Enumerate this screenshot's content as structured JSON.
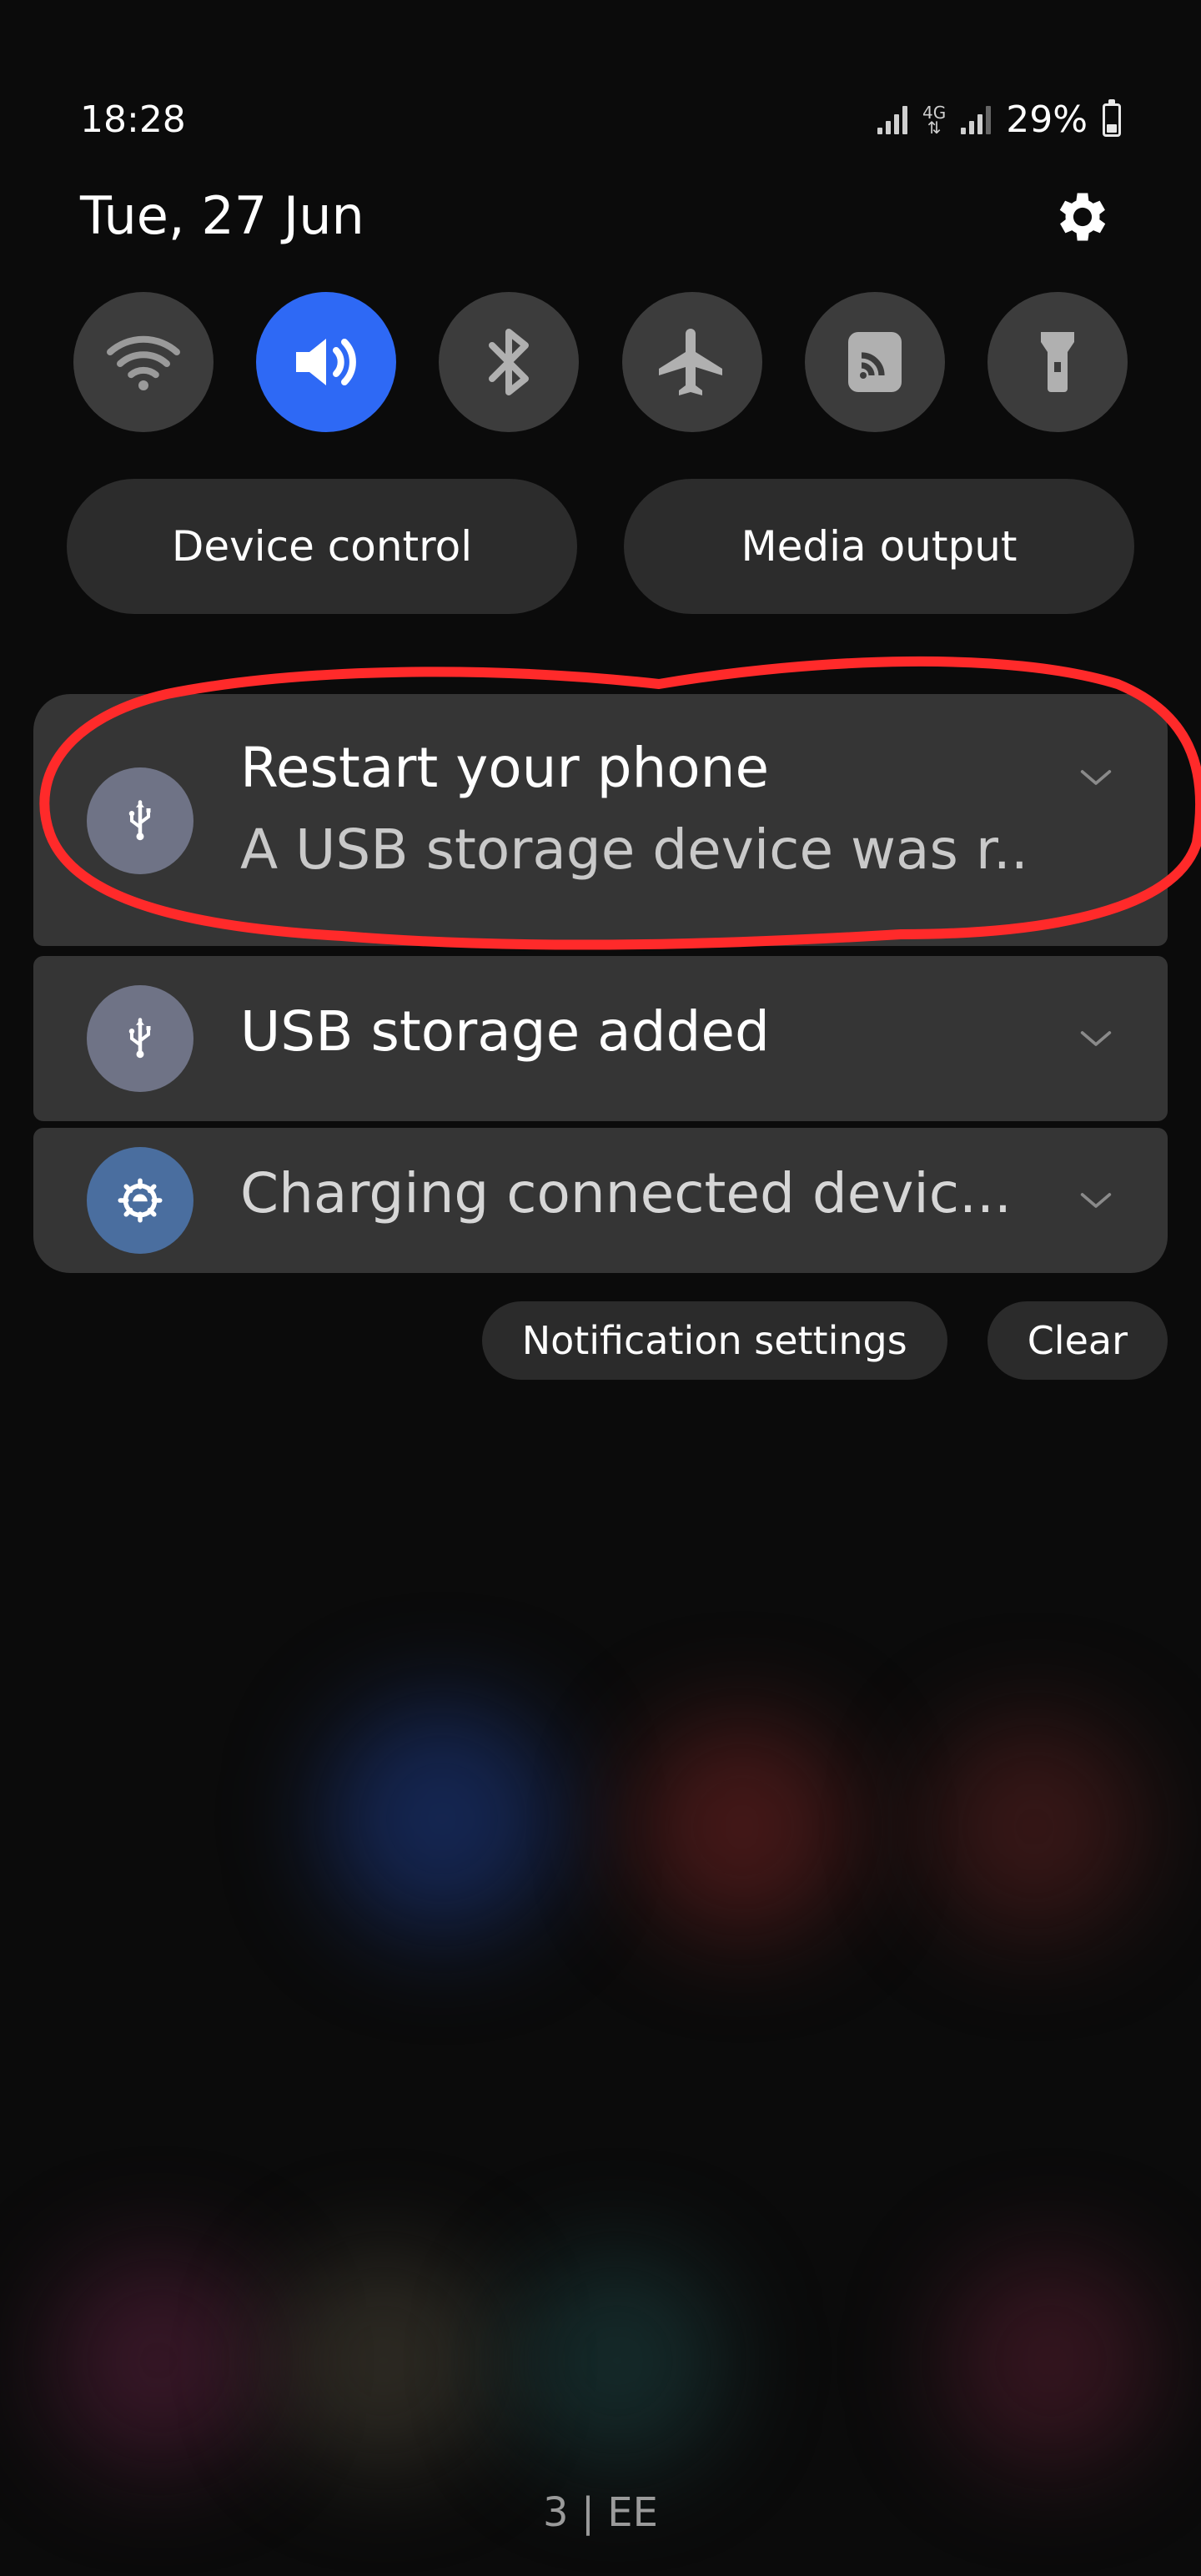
{
  "status": {
    "time": "18:28",
    "network_type": "4G",
    "battery_percent": "29%",
    "battery_level": 0.29
  },
  "header": {
    "date": "Tue, 27 Jun"
  },
  "quick_settings": [
    {
      "icon": "wifi-icon",
      "active": false
    },
    {
      "icon": "sound-icon",
      "active": true
    },
    {
      "icon": "bluetooth-icon",
      "active": false
    },
    {
      "icon": "airplane-mode-icon",
      "active": false
    },
    {
      "icon": "nfc-icon",
      "active": false
    },
    {
      "icon": "flashlight-icon",
      "active": false
    }
  ],
  "pills": {
    "device_control": "Device control",
    "media_output": "Media output"
  },
  "notifications": [
    {
      "icon": "usb-icon",
      "title": "Restart your phone",
      "body": "A USB storage device was r.."
    },
    {
      "icon": "usb-icon",
      "title": "USB storage added"
    },
    {
      "icon": "android-settings-icon",
      "title": "Charging connected devic..."
    }
  ],
  "actions": {
    "notification_settings": "Notification settings",
    "clear": "Clear"
  },
  "carrier": "3 | EE",
  "colors": {
    "accent": "#2e69f5",
    "annotation": "#ff2a2a",
    "card": "#353535",
    "pill": "#2c2c2c"
  }
}
